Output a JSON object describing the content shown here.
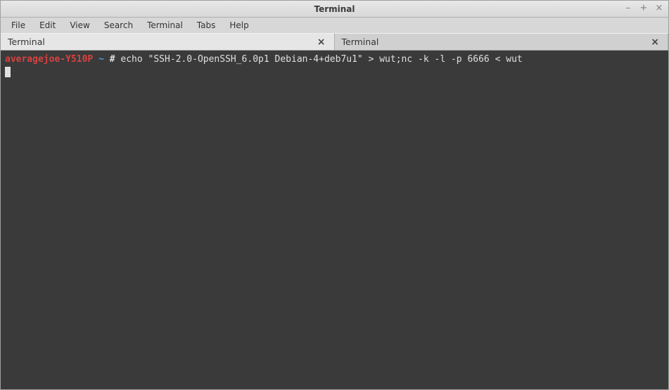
{
  "window": {
    "title": "Terminal"
  },
  "menu": {
    "file": "File",
    "edit": "Edit",
    "view": "View",
    "search": "Search",
    "terminal": "Terminal",
    "tabs": "Tabs",
    "help": "Help"
  },
  "tabs": [
    {
      "label": "Terminal",
      "active": true
    },
    {
      "label": "Terminal",
      "active": false
    }
  ],
  "terminal": {
    "prompt_host": "averagejoe-Y510P",
    "prompt_path": "~",
    "prompt_symbol": "#",
    "command": "echo \"SSH-2.0-OpenSSH_6.0p1 Debian-4+deb7u1\" > wut;nc -k -l -p 6666 < wut"
  },
  "window_controls": {
    "minimize": "–",
    "maximize": "+",
    "close": "×"
  }
}
